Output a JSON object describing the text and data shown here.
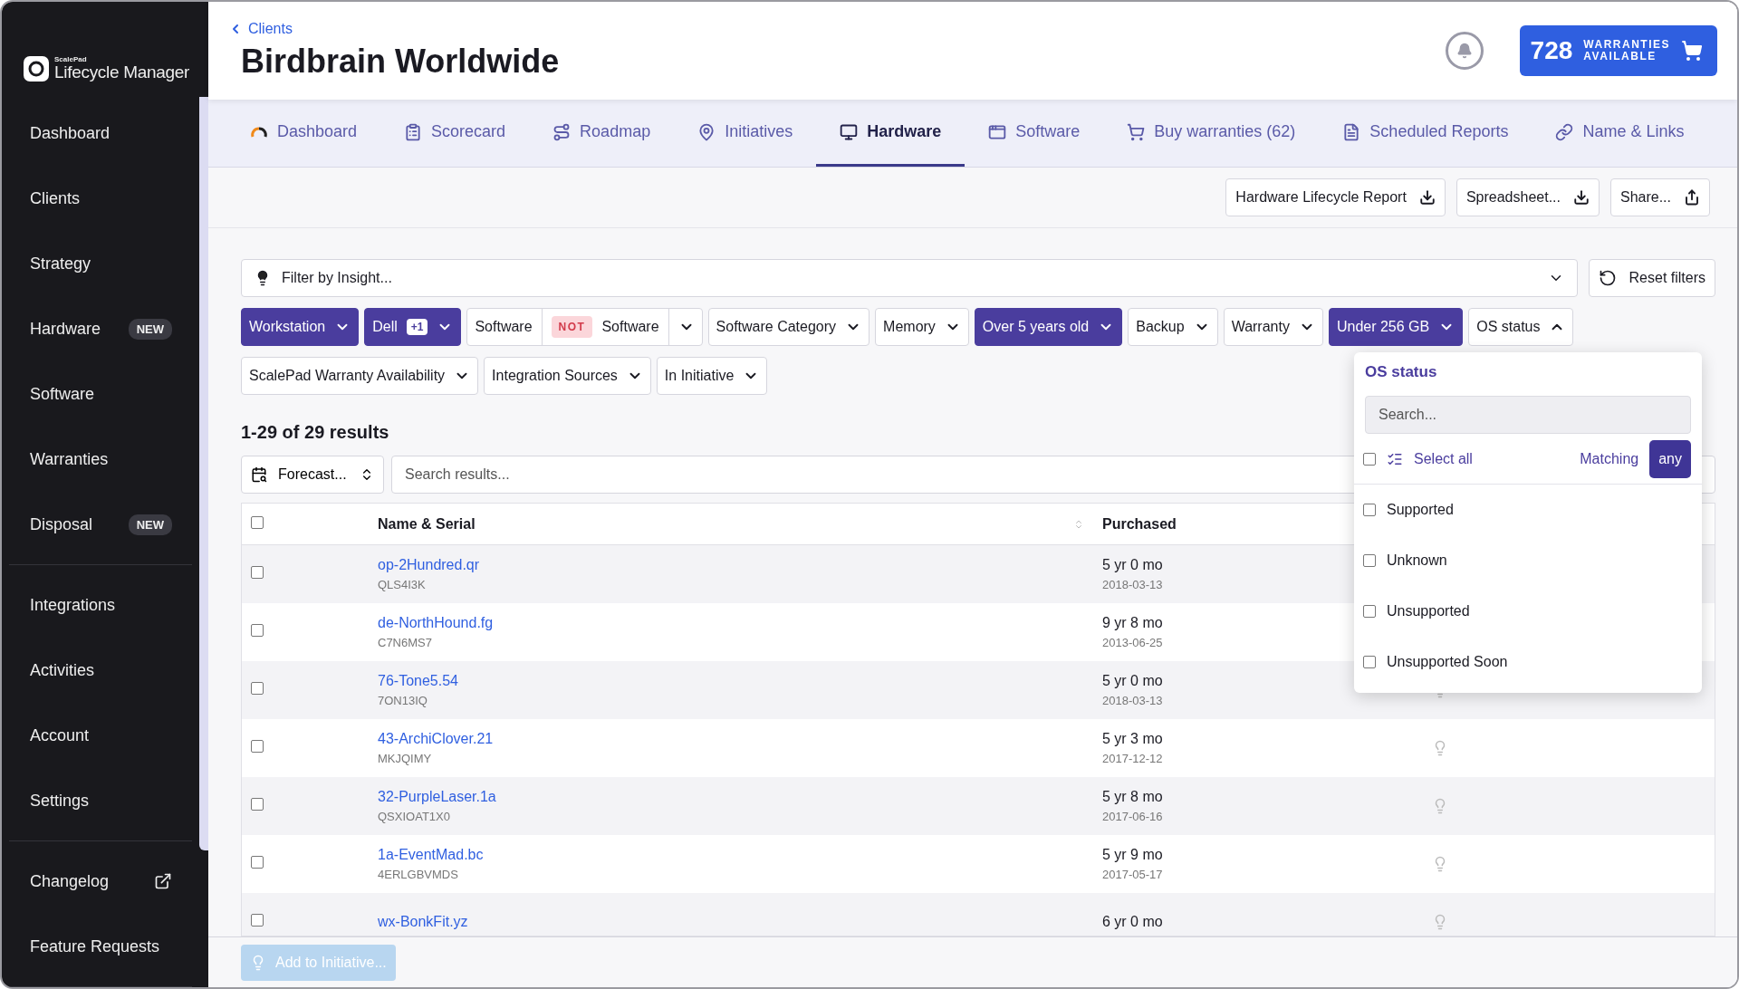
{
  "sidebar": {
    "logo": {
      "brand": "ScalePad",
      "product": "Lifecycle Manager"
    },
    "groups": [
      [
        {
          "label": "Dashboard",
          "kind": "nav"
        },
        {
          "label": "Clients",
          "kind": "nav"
        },
        {
          "label": "Strategy",
          "kind": "nav"
        },
        {
          "label": "Hardware",
          "kind": "nav",
          "badge": "NEW"
        },
        {
          "label": "Software",
          "kind": "nav"
        },
        {
          "label": "Warranties",
          "kind": "nav"
        },
        {
          "label": "Disposal",
          "kind": "nav",
          "badge": "NEW"
        }
      ],
      [
        {
          "label": "Integrations",
          "kind": "nav"
        },
        {
          "label": "Activities",
          "kind": "nav"
        },
        {
          "label": "Account",
          "kind": "nav"
        },
        {
          "label": "Settings",
          "kind": "nav"
        }
      ],
      [
        {
          "label": "Changelog",
          "kind": "external"
        },
        {
          "label": "Feature Requests",
          "kind": "nav"
        }
      ]
    ]
  },
  "header": {
    "breadcrumb": "Clients",
    "title": "Birdbrain Worldwide",
    "warranties": {
      "count": "728",
      "line1": "WARRANTIES",
      "line2": "AVAILABLE"
    }
  },
  "tabs": [
    {
      "label": "Dashboard",
      "selected": false
    },
    {
      "label": "Scorecard",
      "selected": false
    },
    {
      "label": "Roadmap",
      "selected": false
    },
    {
      "label": "Initiatives",
      "selected": false
    },
    {
      "label": "Hardware",
      "selected": true
    },
    {
      "label": "Software",
      "selected": false
    },
    {
      "label": "Buy warranties (62)",
      "selected": false
    },
    {
      "label": "Scheduled Reports",
      "selected": false
    },
    {
      "label": "Name & Links",
      "selected": false
    }
  ],
  "actions": [
    "Hardware Lifecycle Report",
    "Spreadsheet...",
    "Share..."
  ],
  "insight_filter": {
    "placeholder": "Filter by Insight..."
  },
  "reset": "Reset filters",
  "filters": [
    {
      "kind": "active",
      "label": "Workstation",
      "expanded": false
    },
    {
      "kind": "active",
      "label": "Dell",
      "badge": "+1",
      "expanded": false
    },
    {
      "kind": "not",
      "label": "Software",
      "not_label": "NOT",
      "second_label": "Software",
      "expanded": false
    },
    {
      "kind": "plain",
      "label": "Software Category",
      "expanded": false
    },
    {
      "kind": "plain",
      "label": "Memory",
      "expanded": false
    },
    {
      "kind": "active",
      "label": "Over 5 years old",
      "expanded": false
    },
    {
      "kind": "plain",
      "label": "Backup",
      "expanded": false
    },
    {
      "kind": "plain",
      "label": "Warranty",
      "expanded": false
    },
    {
      "kind": "active",
      "label": "Under 256 GB",
      "expanded": false
    },
    {
      "kind": "plain",
      "label": "OS status",
      "expanded": true
    },
    {
      "kind": "plain",
      "label": "ScalePad Warranty Availability",
      "expanded": false
    },
    {
      "kind": "plain",
      "label": "Integration Sources",
      "expanded": false
    },
    {
      "kind": "plain",
      "label": "In Initiative",
      "expanded": false
    }
  ],
  "results_count": "1-29 of 29 results",
  "forecast": "Forecast...",
  "search": {
    "placeholder": "Search results..."
  },
  "table": {
    "all_checked": false,
    "columns": [
      "Name & Serial",
      "Purchased"
    ],
    "rows": [
      {
        "name": "op-2Hundred.qr",
        "serial": "QLS4I3K",
        "age": "5 yr 0 mo",
        "date": "2018-03-13",
        "checked": false
      },
      {
        "name": "de-NorthHound.fg",
        "serial": "C7N6MS7",
        "age": "9 yr 8 mo",
        "date": "2013-06-25",
        "checked": false
      },
      {
        "name": "76-Tone5.54",
        "serial": "7ON13IQ",
        "age": "5 yr 0 mo",
        "date": "2018-03-13",
        "checked": false
      },
      {
        "name": "43-ArchiClover.21",
        "serial": "MKJQIMY",
        "age": "5 yr 3 mo",
        "date": "2017-12-12",
        "checked": false
      },
      {
        "name": "32-PurpleLaser.1a",
        "serial": "QSXIOAT1X0",
        "age": "5 yr 8 mo",
        "date": "2017-06-16",
        "checked": false
      },
      {
        "name": "1a-EventMad.bc",
        "serial": "4ERLGBVMDS",
        "age": "5 yr 9 mo",
        "date": "2017-05-17",
        "checked": false
      },
      {
        "name": "wx-BonkFit.yz",
        "age": "6 yr 0 mo",
        "checked": false
      }
    ]
  },
  "os_dropdown": {
    "title": "OS status",
    "search_placeholder": "Search...",
    "select_all": "Select all",
    "select_all_checked": false,
    "matching_label": "Matching",
    "matching_value": "any",
    "options": [
      {
        "label": "Supported",
        "checked": false
      },
      {
        "label": "Unknown",
        "checked": false
      },
      {
        "label": "Unsupported",
        "checked": false
      },
      {
        "label": "Unsupported Soon",
        "checked": false
      }
    ]
  },
  "footer": {
    "button": "Add to Initiative...",
    "disabled": true
  }
}
